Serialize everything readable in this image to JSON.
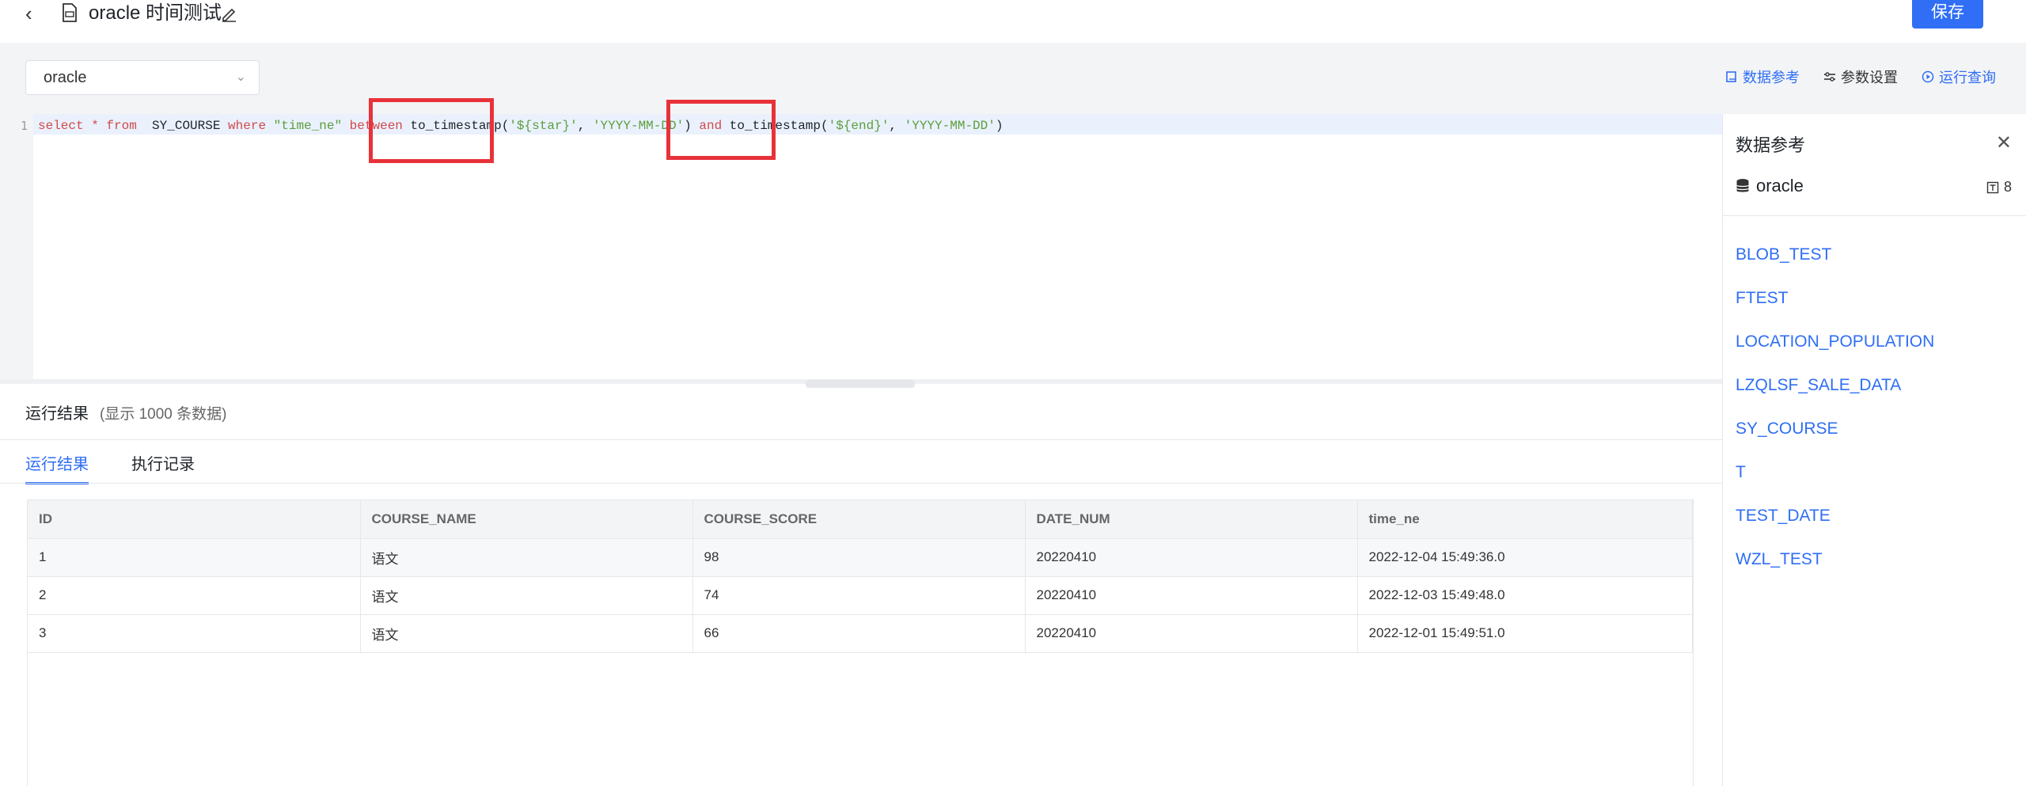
{
  "header": {
    "title": "oracle 时间测试",
    "save_label": "保存"
  },
  "toolbar": {
    "datasource_value": "oracle",
    "data_reference_label": "数据参考",
    "param_settings_label": "参数设置",
    "run_query_label": "运行查询"
  },
  "editor": {
    "line_number": "1",
    "tokens": {
      "t1": "select * from",
      "t2": "  SY_COURSE ",
      "t3": "where ",
      "t4": "\"time_ne\"",
      "t5": " between ",
      "t6": "to_timestamp(",
      "t7": "'${star}'",
      "t8": ", ",
      "t9": "'YYYY-MM-DD'",
      "t10": ") ",
      "t11": "and ",
      "t12": "to_timestamp(",
      "t13": "'${end}'",
      "t14": ", ",
      "t15": "'YYYY-MM-DD'",
      "t16": ")"
    }
  },
  "results": {
    "title": "运行结果",
    "subtitle": "(显示 1000 条数据)",
    "tabs": [
      {
        "label": "运行结果"
      },
      {
        "label": "执行记录"
      }
    ],
    "columns": [
      "ID",
      "COURSE_NAME",
      "COURSE_SCORE",
      "DATE_NUM",
      "time_ne"
    ],
    "rows": [
      [
        "1",
        "语文",
        "98",
        "20220410",
        "2022-12-04 15:49:36.0"
      ],
      [
        "2",
        "语文",
        "74",
        "20220410",
        "2022-12-03 15:49:48.0"
      ],
      [
        "3",
        "语文",
        "66",
        "20220410",
        "2022-12-01 15:49:51.0"
      ]
    ]
  },
  "panel": {
    "title": "数据参考",
    "db_name": "oracle",
    "table_count": "8",
    "tables": [
      "BLOB_TEST",
      "FTEST",
      "LOCATION_POPULATION",
      "LZQLSF_SALE_DATA",
      "SY_COURSE",
      "T",
      "TEST_DATE",
      "WZL_TEST"
    ]
  },
  "colors": {
    "accent": "#2f6ef5",
    "highlight_box": "#e8323a"
  }
}
